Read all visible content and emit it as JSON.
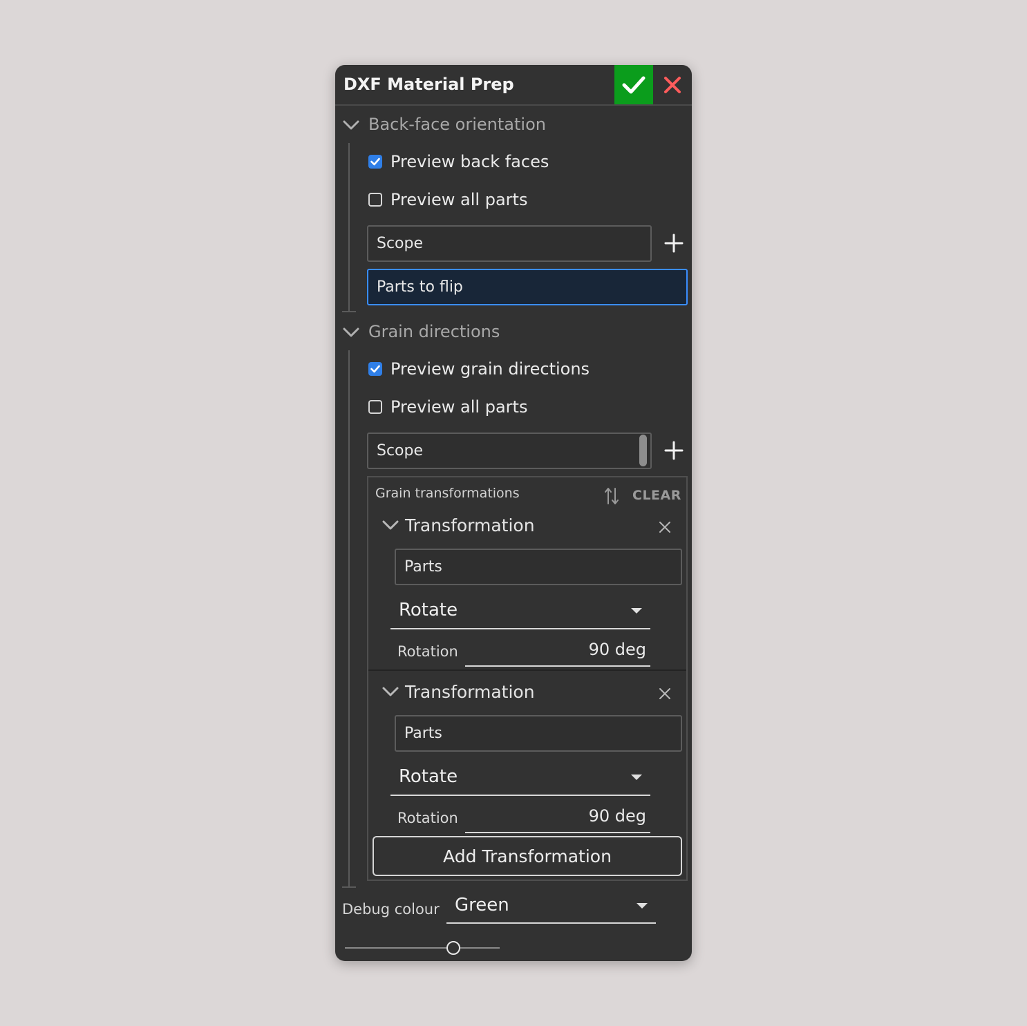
{
  "dialog": {
    "title": "DXF Material Prep",
    "accept_icon": "checkmark-icon",
    "cancel_icon": "close-icon",
    "accent_color": "#0b9d1c",
    "cancel_color": "#ff5c5c"
  },
  "back_face": {
    "title": "Back-face orientation",
    "preview_back_faces": {
      "label": "Preview back faces",
      "checked": true
    },
    "preview_all_parts": {
      "label": "Preview all parts",
      "checked": false
    },
    "scope_placeholder": "Scope",
    "parts_to_flip_placeholder": "Parts to flip"
  },
  "grain": {
    "title": "Grain directions",
    "preview_grain": {
      "label": "Preview grain directions",
      "checked": true
    },
    "preview_all_parts": {
      "label": "Preview all parts",
      "checked": false
    },
    "scope_placeholder": "Scope",
    "list_label": "Grain transformations",
    "clear_label": "CLEAR",
    "transformations": [
      {
        "title": "Transformation",
        "parts_placeholder": "Parts",
        "type": "Rotate",
        "rotation_label": "Rotation",
        "rotation_value": "90 deg"
      },
      {
        "title": "Transformation",
        "parts_placeholder": "Parts",
        "type": "Rotate",
        "rotation_label": "Rotation",
        "rotation_value": "90 deg"
      }
    ],
    "add_label": "Add Transformation"
  },
  "debug": {
    "label": "Debug colour",
    "value": "Green",
    "slider_fraction": 0.7
  }
}
